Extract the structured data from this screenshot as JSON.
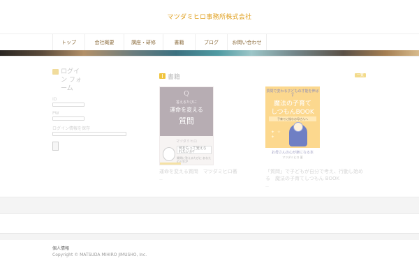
{
  "header": {
    "site_title": "マツダミヒロ事務所株式会社"
  },
  "nav": {
    "items": [
      {
        "label": "トップ",
        "width": 46
      },
      {
        "label": "会社概要",
        "width": 56
      },
      {
        "label": "講座・研修",
        "width": 56
      },
      {
        "label": "書籍",
        "width": 46
      },
      {
        "label": "ブログ",
        "width": 46
      },
      {
        "label": "お問い合わせ",
        "width": 56
      }
    ]
  },
  "sidebar": {
    "login_title": "ログイン フォーム",
    "username_label": "ID",
    "password_label": "PW",
    "remember_label": "ログイン情報を保存",
    "login_button_label": ""
  },
  "main": {
    "section_title": "書籍",
    "more_label": "一覧",
    "books": [
      {
        "cover": {
          "q": "Q",
          "line1": "答えるたびに",
          "title1": "運命を変える",
          "title2": "質問",
          "author": "マツダミヒロ",
          "bubble": "何をもって覚えられたいか？",
          "small": "質問に答えるたびに あなたの人生が"
        },
        "badge": "",
        "title": "運命を変える質問　マツダミヒロ著",
        "meta": "—"
      },
      {
        "cover": {
          "small": "質問で変わる子どもの才能を伸ばす",
          "title1": "魔法の子育て",
          "title2": "しつもんBOOK",
          "sub": "子育てに悩むお母さんへ",
          "stars": "✦ ✧ ✦",
          "b1": "お母さんの心が楽になる本",
          "b2": "マツダミヒロ 著"
        },
        "title": "「質問」で子どもが自分で考え、行動し始める　魔法の子育てしつもん BOOK",
        "meta": "—"
      }
    ]
  },
  "footer": {
    "link": "個人情報",
    "copyright": "Copyright © MATSUDA MIHIRO JIMUSHO, Inc."
  }
}
